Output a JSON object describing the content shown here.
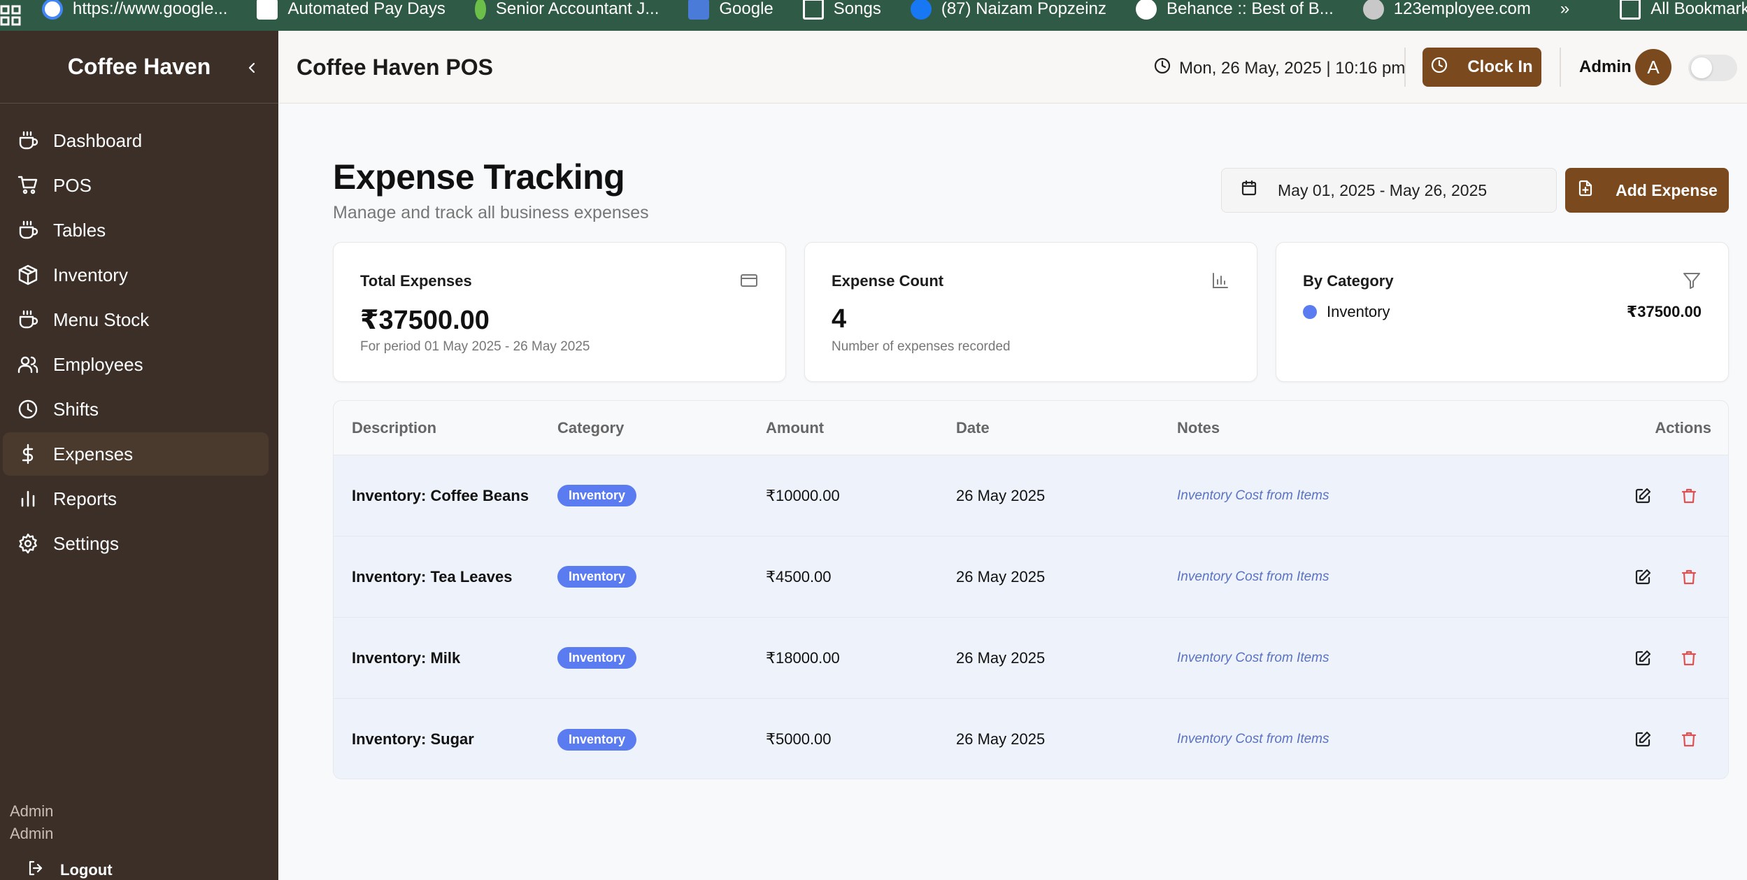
{
  "bookmarks": {
    "items": [
      {
        "label": "https://www.google...",
        "icon": "google-icon",
        "color": "#4285f4"
      },
      {
        "label": "Automated Pay Days",
        "icon": "page-icon",
        "color": "#ffffff"
      },
      {
        "label": "Senior Accountant J...",
        "icon": "leaf-icon",
        "color": "#6cc04a"
      },
      {
        "label": "Google",
        "icon": "google-sites-icon",
        "color": "#4a7bd8"
      },
      {
        "label": "Songs",
        "icon": "folder-icon",
        "color": "#ffffff"
      },
      {
        "label": "(87) Naizam Popzeinz",
        "icon": "facebook-icon",
        "color": "#1877f2"
      },
      {
        "label": "Behance :: Best of B...",
        "icon": "globe-icon",
        "color": "#ffffff"
      },
      {
        "label": "123employee.com",
        "icon": "site-icon",
        "color": "#c8c8c8"
      }
    ],
    "overflow": "»",
    "all_bookmarks": "All Bookmarks"
  },
  "sidebar": {
    "brand": "Coffee Haven",
    "collapse_icon": "chevron-left-icon",
    "items": [
      {
        "label": "Dashboard",
        "icon": "coffee-cup-icon"
      },
      {
        "label": "POS",
        "icon": "cart-icon"
      },
      {
        "label": "Tables",
        "icon": "coffee-cup-icon"
      },
      {
        "label": "Inventory",
        "icon": "package-icon"
      },
      {
        "label": "Menu Stock",
        "icon": "coffee-cup-icon"
      },
      {
        "label": "Employees",
        "icon": "users-icon"
      },
      {
        "label": "Shifts",
        "icon": "clock-icon"
      },
      {
        "label": "Expenses",
        "icon": "dollar-icon",
        "active": true
      },
      {
        "label": "Reports",
        "icon": "bar-chart-icon"
      },
      {
        "label": "Settings",
        "icon": "gear-icon"
      }
    ],
    "user_name": "Admin",
    "user_role": "Admin",
    "logout": "Logout"
  },
  "topbar": {
    "title": "Coffee Haven POS",
    "datetime": "Mon, 26 May, 2025 | 10:16 pm",
    "clock_in": "Clock In",
    "admin": "Admin",
    "avatar_letter": "A"
  },
  "main": {
    "title": "Expense Tracking",
    "subtitle": "Manage and track all business expenses",
    "date_range": "May 01, 2025 - May 26, 2025",
    "add_expense": "Add Expense"
  },
  "cards": {
    "total": {
      "label": "Total Expenses",
      "value": "₹37500.00",
      "note": "For period 01 May 2025 - 26 May 2025"
    },
    "count": {
      "label": "Expense Count",
      "value": "4",
      "note": "Number of expenses recorded"
    },
    "category": {
      "label": "By Category",
      "name": "Inventory",
      "amount": "₹37500.00",
      "dot_color": "#5b7cf0"
    }
  },
  "table": {
    "headers": {
      "description": "Description",
      "category": "Category",
      "amount": "Amount",
      "date": "Date",
      "notes": "Notes",
      "actions": "Actions"
    },
    "rows": [
      {
        "description": "Inventory: Coffee Beans",
        "category": "Inventory",
        "amount": "₹10000.00",
        "date": "26 May 2025",
        "notes": "Inventory Cost from Items"
      },
      {
        "description": "Inventory: Tea Leaves",
        "category": "Inventory",
        "amount": "₹4500.00",
        "date": "26 May 2025",
        "notes": "Inventory Cost from Items"
      },
      {
        "description": "Inventory: Milk",
        "category": "Inventory",
        "amount": "₹18000.00",
        "date": "26 May 2025",
        "notes": "Inventory Cost from Items"
      },
      {
        "description": "Inventory: Sugar",
        "category": "Inventory",
        "amount": "₹5000.00",
        "date": "26 May 2025",
        "notes": "Inventory Cost from Items"
      }
    ]
  },
  "colors": {
    "sidebar_bg": "#3b2f28",
    "brand_brown": "#7a4a1e",
    "badge_blue": "#5b7cf0",
    "delete_red": "#e05252",
    "bookmarks_bg": "#2f5a45"
  }
}
